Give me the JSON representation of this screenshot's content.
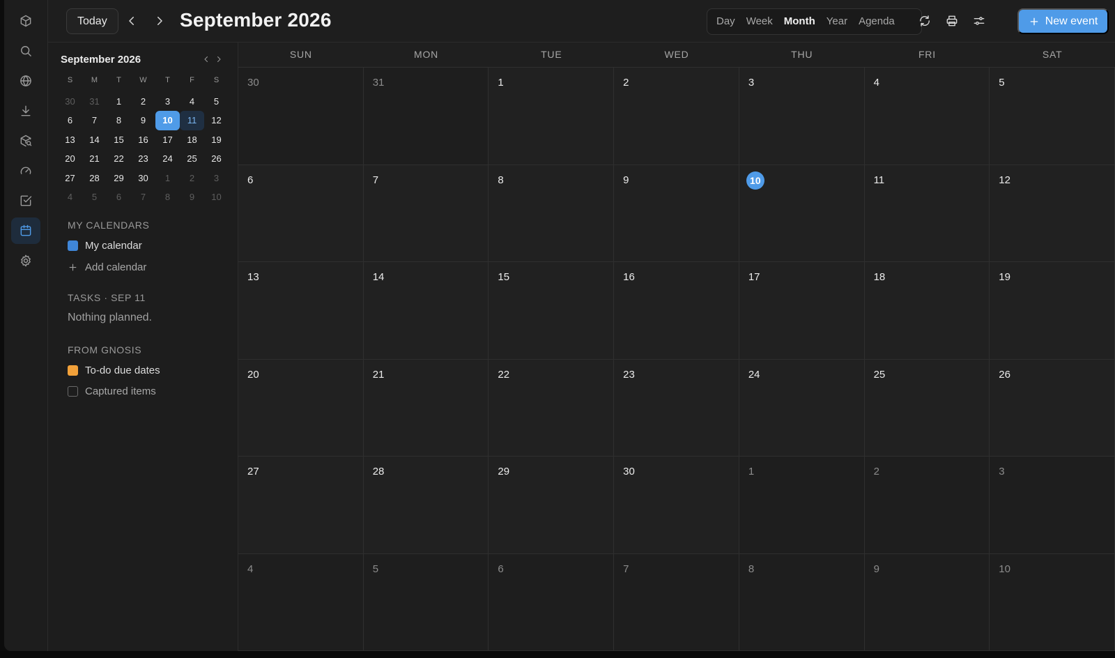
{
  "header": {
    "today_label": "Today",
    "title": "September 2026",
    "views": [
      "Day",
      "Week",
      "Month",
      "Year",
      "Agenda"
    ],
    "active_view": "Month",
    "new_event_label": "New event"
  },
  "rail": {
    "icons": [
      "cube-icon",
      "search-icon",
      "globe-icon",
      "download-icon",
      "package-search-icon",
      "gauge-icon",
      "check-square-icon",
      "calendar-icon",
      "gear-icon"
    ],
    "active": "calendar-icon"
  },
  "mini_calendar": {
    "title": "September 2026",
    "dow": [
      "S",
      "M",
      "T",
      "W",
      "T",
      "F",
      "S"
    ],
    "weeks": [
      [
        {
          "d": "30",
          "out": true
        },
        {
          "d": "31",
          "out": true
        },
        {
          "d": "1"
        },
        {
          "d": "2"
        },
        {
          "d": "3"
        },
        {
          "d": "4"
        },
        {
          "d": "5"
        }
      ],
      [
        {
          "d": "6"
        },
        {
          "d": "7"
        },
        {
          "d": "8"
        },
        {
          "d": "9"
        },
        {
          "d": "10",
          "today": true
        },
        {
          "d": "11",
          "sel": true
        },
        {
          "d": "12"
        }
      ],
      [
        {
          "d": "13"
        },
        {
          "d": "14"
        },
        {
          "d": "15"
        },
        {
          "d": "16"
        },
        {
          "d": "17"
        },
        {
          "d": "18"
        },
        {
          "d": "19"
        }
      ],
      [
        {
          "d": "20"
        },
        {
          "d": "21"
        },
        {
          "d": "22"
        },
        {
          "d": "23"
        },
        {
          "d": "24"
        },
        {
          "d": "25"
        },
        {
          "d": "26"
        }
      ],
      [
        {
          "d": "27"
        },
        {
          "d": "28"
        },
        {
          "d": "29"
        },
        {
          "d": "30"
        },
        {
          "d": "1",
          "out": true
        },
        {
          "d": "2",
          "out": true
        },
        {
          "d": "3",
          "out": true
        }
      ],
      [
        {
          "d": "4",
          "out": true
        },
        {
          "d": "5",
          "out": true
        },
        {
          "d": "6",
          "out": true
        },
        {
          "d": "7",
          "out": true
        },
        {
          "d": "8",
          "out": true
        },
        {
          "d": "9",
          "out": true
        },
        {
          "d": "10",
          "out": true
        }
      ]
    ]
  },
  "sidebar": {
    "my_calendars_label": "MY CALENDARS",
    "my_calendar": {
      "label": "My calendar",
      "color": "#3f86d8"
    },
    "add_calendar_label": "Add calendar",
    "tasks_label": "TASKS · SEP 11",
    "tasks_empty": "Nothing planned.",
    "from_gnosis_label": "FROM GNOSIS",
    "todo_due": {
      "label": "To-do due dates",
      "color": "#f2a13a"
    },
    "captured": {
      "label": "Captured items"
    }
  },
  "month": {
    "dow": [
      "SUN",
      "MON",
      "TUE",
      "WED",
      "THU",
      "FRI",
      "SAT"
    ],
    "weeks": [
      [
        {
          "d": "30",
          "out": true
        },
        {
          "d": "31",
          "out": true
        },
        {
          "d": "1"
        },
        {
          "d": "2"
        },
        {
          "d": "3"
        },
        {
          "d": "4"
        },
        {
          "d": "5"
        }
      ],
      [
        {
          "d": "6"
        },
        {
          "d": "7"
        },
        {
          "d": "8"
        },
        {
          "d": "9"
        },
        {
          "d": "10",
          "today": true
        },
        {
          "d": "11"
        },
        {
          "d": "12"
        }
      ],
      [
        {
          "d": "13"
        },
        {
          "d": "14"
        },
        {
          "d": "15"
        },
        {
          "d": "16"
        },
        {
          "d": "17"
        },
        {
          "d": "18"
        },
        {
          "d": "19"
        }
      ],
      [
        {
          "d": "20"
        },
        {
          "d": "21"
        },
        {
          "d": "22"
        },
        {
          "d": "23"
        },
        {
          "d": "24"
        },
        {
          "d": "25"
        },
        {
          "d": "26"
        }
      ],
      [
        {
          "d": "27"
        },
        {
          "d": "28"
        },
        {
          "d": "29"
        },
        {
          "d": "30"
        },
        {
          "d": "1",
          "out": true
        },
        {
          "d": "2",
          "out": true
        },
        {
          "d": "3",
          "out": true
        }
      ],
      [
        {
          "d": "4",
          "out": true
        },
        {
          "d": "5",
          "out": true
        },
        {
          "d": "6",
          "out": true
        },
        {
          "d": "7",
          "out": true
        },
        {
          "d": "8",
          "out": true
        },
        {
          "d": "9",
          "out": true
        },
        {
          "d": "10",
          "out": true
        }
      ]
    ]
  },
  "colors": {
    "accent": "#4f9be8",
    "background": "#1f1f1f"
  }
}
